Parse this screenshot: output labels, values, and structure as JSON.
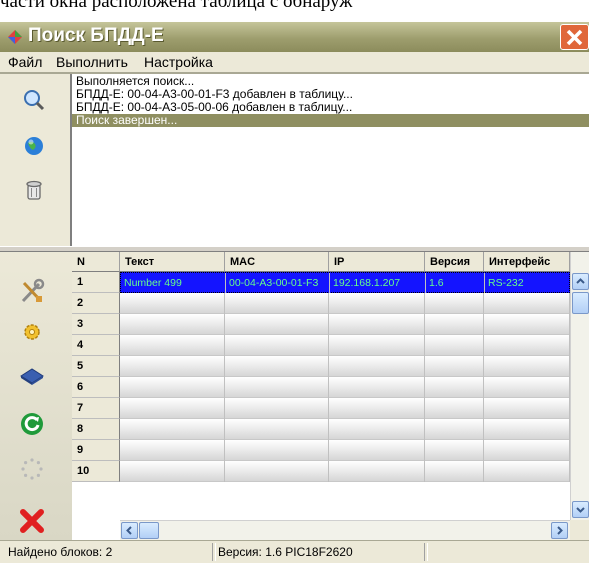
{
  "document_text": "части окна расположена таблица с обнаруж",
  "window": {
    "title": "Поиск БПДД-Е"
  },
  "menu": {
    "items": [
      {
        "label": "Файл"
      },
      {
        "label": "Выполнить"
      },
      {
        "label": "Настройка"
      }
    ]
  },
  "log": {
    "lines": [
      "Выполняется поиск...",
      "БПДД-Е: 00-04-A3-00-01-F3 добавлен в таблицу...",
      "БПДД-Е: 00-04-A3-05-00-06 добавлен в таблицу...",
      "Поиск завершен..."
    ]
  },
  "table": {
    "row_header": "N",
    "columns": [
      "Текст",
      "MAC",
      "IP",
      "Версия",
      "Интерфейс"
    ],
    "rows": [
      {
        "n": "1",
        "cells": [
          "Number 499",
          "00-04-A3-00-01-F3",
          "192.168.1.207",
          "1.6",
          "RS-232"
        ],
        "selected": true
      },
      {
        "n": "2",
        "cells": [
          "",
          "",
          "",
          "",
          ""
        ]
      },
      {
        "n": "3",
        "cells": [
          "",
          "",
          "",
          "",
          ""
        ]
      },
      {
        "n": "4",
        "cells": [
          "",
          "",
          "",
          "",
          ""
        ]
      },
      {
        "n": "5",
        "cells": [
          "",
          "",
          "",
          "",
          ""
        ]
      },
      {
        "n": "6",
        "cells": [
          "",
          "",
          "",
          "",
          ""
        ]
      },
      {
        "n": "7",
        "cells": [
          "",
          "",
          "",
          "",
          ""
        ]
      },
      {
        "n": "8",
        "cells": [
          "",
          "",
          "",
          "",
          ""
        ]
      },
      {
        "n": "9",
        "cells": [
          "",
          "",
          "",
          "",
          ""
        ]
      },
      {
        "n": "10",
        "cells": [
          "",
          "",
          "",
          "",
          ""
        ]
      }
    ]
  },
  "status": {
    "found": "Найдено блоков: 2",
    "version": "Версия: 1.6   PIC18F2620"
  },
  "icons": {
    "top_tools": [
      "search-icon",
      "globe-icon",
      "trash-icon"
    ],
    "side_tools": [
      "tools-icon",
      "gear-icon",
      "chip-icon",
      "refresh-icon",
      "spinner-icon",
      "exit-icon"
    ]
  },
  "colors": {
    "title_bar": "#9e9e6e",
    "selected_row_bg": "#1414ff",
    "selected_row_text": "#67ff8b",
    "log_selection": "#8f8f61",
    "close_button": "#e0673a"
  }
}
